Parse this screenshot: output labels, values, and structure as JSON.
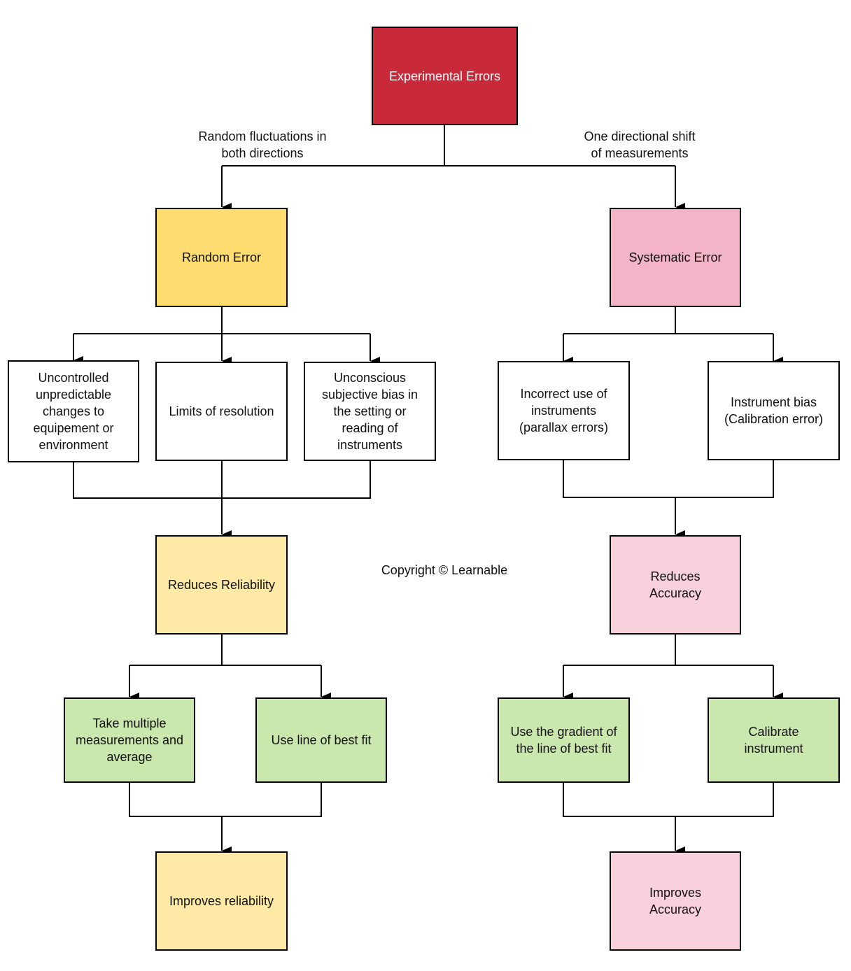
{
  "title": "Experimental Errors",
  "colors": {
    "root": "#c92a3a",
    "random": "#fedc6f",
    "random_light": "#feeaa6",
    "systematic": "#f3b4c7",
    "systematic_light": "#f9d1dc",
    "action": "#cae7ad",
    "cause": "#ffffff",
    "line": "#000000"
  },
  "branch_labels": {
    "random": "Random fluctuations in\nboth directions",
    "systematic": "One directional shift\nof measurements"
  },
  "copyright": "Copyright © Learnable",
  "nodes": {
    "root": "Experimental Errors",
    "random_error": "Random Error",
    "systematic_error": "Systematic Error",
    "random_causes": [
      "Uncontrolled\nunpredictable\nchanges to\nequipement or\nenvironment",
      "Limits of resolution",
      "Unconscious\nsubjective bias in\nthe setting or\nreading of\ninstruments"
    ],
    "systematic_causes": [
      "Incorrect use of\ninstruments\n(parallax errors)",
      "Instrument bias\n(Calibration error)"
    ],
    "reduces_reliability": "Reduces Reliability",
    "reduces_accuracy": "Reduces\nAccuracy",
    "random_remedies": [
      "Take multiple\nmeasurements and\naverage",
      "Use line of best fit"
    ],
    "systematic_remedies": [
      "Use the gradient of\nthe line of best fit",
      "Calibrate\ninstrument"
    ],
    "improves_reliability": "Improves reliability",
    "improves_accuracy": "Improves\nAccuracy"
  }
}
